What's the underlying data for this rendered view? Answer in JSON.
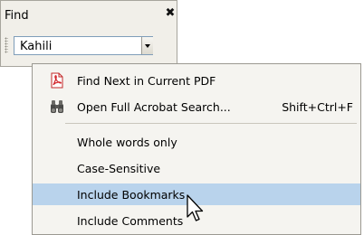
{
  "panel": {
    "title": "Find",
    "close_glyph": "✖",
    "search_value": "Kahili"
  },
  "menu": {
    "items": [
      {
        "label": "Find Next in Current PDF",
        "shortcut": "",
        "icon": "pdf-icon"
      },
      {
        "label": "Open Full Acrobat Search...",
        "shortcut": "Shift+Ctrl+F",
        "icon": "binoculars-icon"
      },
      {
        "label": "Whole words only",
        "shortcut": ""
      },
      {
        "label": "Case-Sensitive",
        "shortcut": ""
      },
      {
        "label": "Include Bookmarks",
        "shortcut": "",
        "highlighted": true
      },
      {
        "label": "Include Comments",
        "shortcut": ""
      }
    ]
  },
  "colors": {
    "highlight": "#b9d3ec",
    "pdf_icon_red": "#d2242a"
  }
}
